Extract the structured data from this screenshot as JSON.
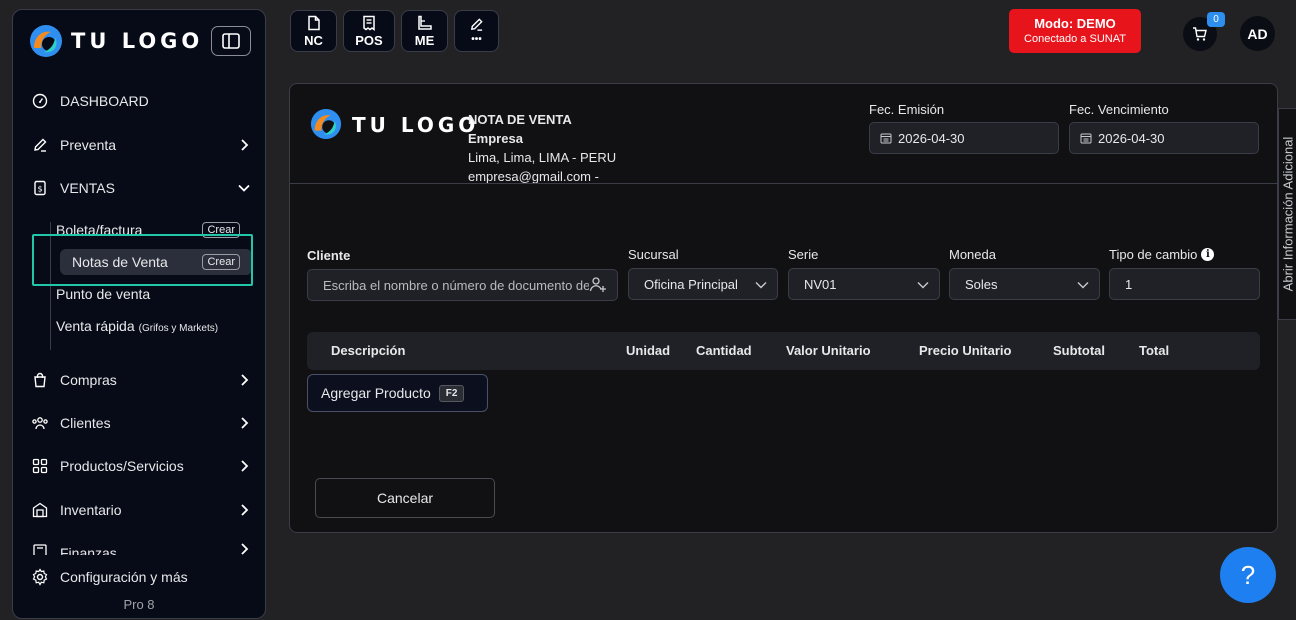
{
  "brand": {
    "logo_text": "TU LOGO"
  },
  "sidebar": {
    "items": [
      {
        "label": "DASHBOARD",
        "icon": "dashboard-gauge-icon"
      },
      {
        "label": "Preventa",
        "icon": "edit-icon"
      },
      {
        "label": "VENTAS",
        "icon": "receipt-icon"
      },
      {
        "label": "Compras",
        "icon": "shopping-bag-icon"
      },
      {
        "label": "Clientes",
        "icon": "users-icon"
      },
      {
        "label": "Productos/Servicios",
        "icon": "grid-icon"
      },
      {
        "label": "Inventario",
        "icon": "warehouse-icon"
      },
      {
        "label": "Finanzas",
        "icon": "finance-icon"
      },
      {
        "label": "Configuración y más",
        "icon": "gear-icon"
      }
    ],
    "ventas_sub": [
      {
        "label": "Boleta/factura",
        "badge": "Crear"
      },
      {
        "label": "Notas de Venta",
        "badge": "Crear"
      },
      {
        "label": "Punto de venta"
      },
      {
        "label": "Venta rápida",
        "small": "(Grifos y Markets)"
      }
    ],
    "version": "Pro 8"
  },
  "toolbar": {
    "buttons": [
      {
        "label": "NC",
        "icon": "document-icon"
      },
      {
        "label": "POS",
        "icon": "receipt-icon"
      },
      {
        "label": "ME",
        "icon": "boot-icon"
      },
      {
        "label": "•••",
        "icon": "edit-icon"
      }
    ]
  },
  "mode": {
    "title": "Modo: DEMO",
    "subtitle": "Conectado a SUNAT"
  },
  "cart": {
    "count": "0"
  },
  "user": {
    "initials": "AD"
  },
  "document": {
    "type": "NOTA DE VENTA",
    "company": "Empresa",
    "address": "Lima, Lima, LIMA - PERU",
    "email": "empresa@gmail.com -",
    "emission_label": "Fec. Emisión",
    "emission_value": "2026-04-30",
    "due_label": "Fec. Vencimiento",
    "due_value": "2026-04-30"
  },
  "form": {
    "client_label": "Cliente",
    "client_placeholder": "Escriba el nombre o número de documento del cliente",
    "branch_label": "Sucursal",
    "branch_value": "Oficina Principal",
    "series_label": "Serie",
    "series_value": "NV01",
    "currency_label": "Moneda",
    "currency_value": "Soles",
    "exchange_label": "Tipo de cambio",
    "exchange_value": "1"
  },
  "table": {
    "columns": [
      "Descripción",
      "Unidad",
      "Cantidad",
      "Valor Unitario",
      "Precio Unitario",
      "Subtotal",
      "Total"
    ]
  },
  "actions": {
    "add_product": "Agregar Producto",
    "add_product_key": "F2",
    "cancel": "Cancelar"
  },
  "side_tab": "Abrir Información Adicional",
  "help": "?",
  "colors": {
    "accent": "#21c7a8",
    "danger": "#e8141c",
    "primary": "#1e7ff0"
  }
}
